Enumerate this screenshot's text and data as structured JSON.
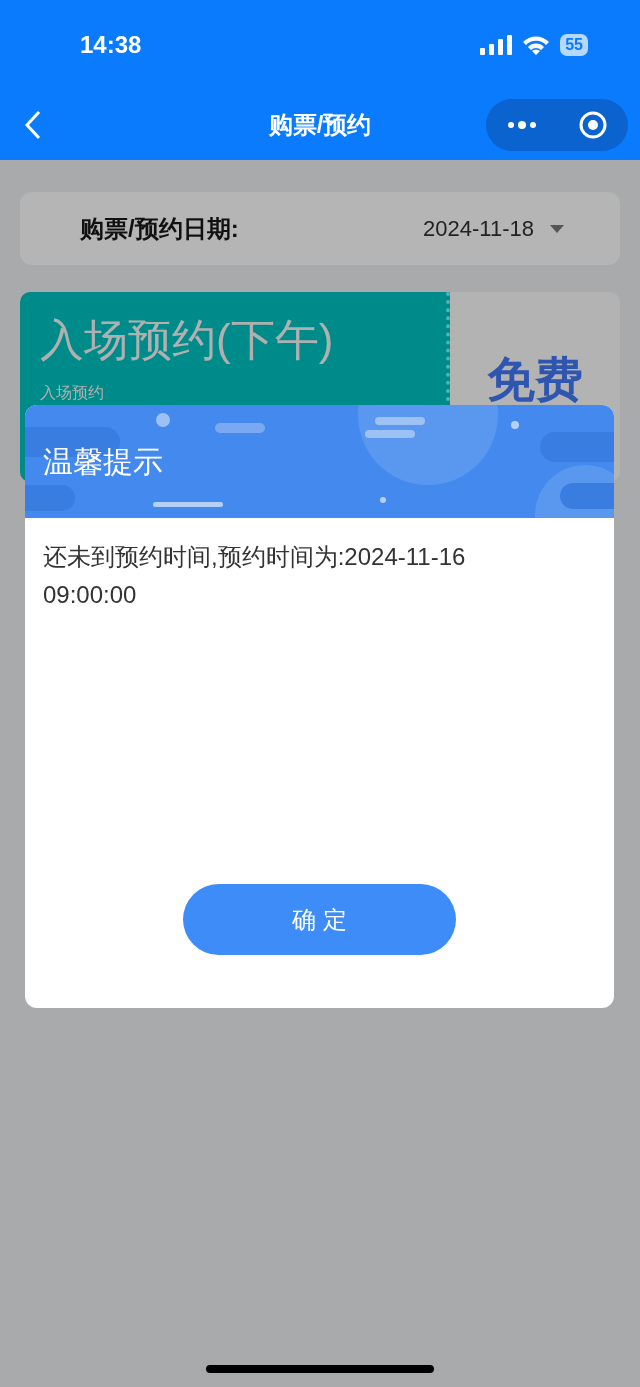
{
  "status_bar": {
    "time": "14:38",
    "battery": "55"
  },
  "nav": {
    "title": "购票/预约"
  },
  "date_picker": {
    "label": "购票/预约日期:",
    "value": "2024-11-18"
  },
  "ticket": {
    "title": "入场预约(下午)",
    "subtitle": "入场预约",
    "price": "免费"
  },
  "dialog": {
    "title": "温馨提示",
    "message": "还未到预约时间,预约时间为:2024-11-16 09:00:00",
    "button": "确 定"
  }
}
